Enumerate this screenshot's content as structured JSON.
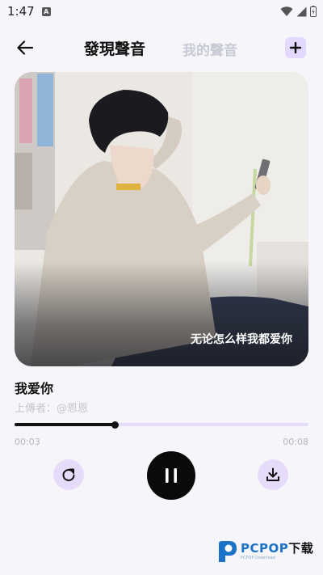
{
  "status_bar": {
    "time": "1:47",
    "notification_badge": "A"
  },
  "header": {
    "tab_discover": "發現聲音",
    "tab_my_voices": "我的聲音"
  },
  "cover": {
    "caption": "无论怎么样我都爱你"
  },
  "song": {
    "title": "我爱你",
    "uploader": "上傳者：@恩恩"
  },
  "player": {
    "current_time": "00:03",
    "total_time": "00:08",
    "progress": 0.34,
    "state": "playing"
  },
  "watermark": {
    "brand": "PCPOP",
    "brand_cn": "下载",
    "tagline": "PCPOP Download"
  },
  "colors": {
    "background": "#f6f6fa",
    "accent_light": "#e6dcfa",
    "primary": "#111111",
    "muted": "#c4c6cf",
    "watermark_blue": "#1a73c9"
  }
}
